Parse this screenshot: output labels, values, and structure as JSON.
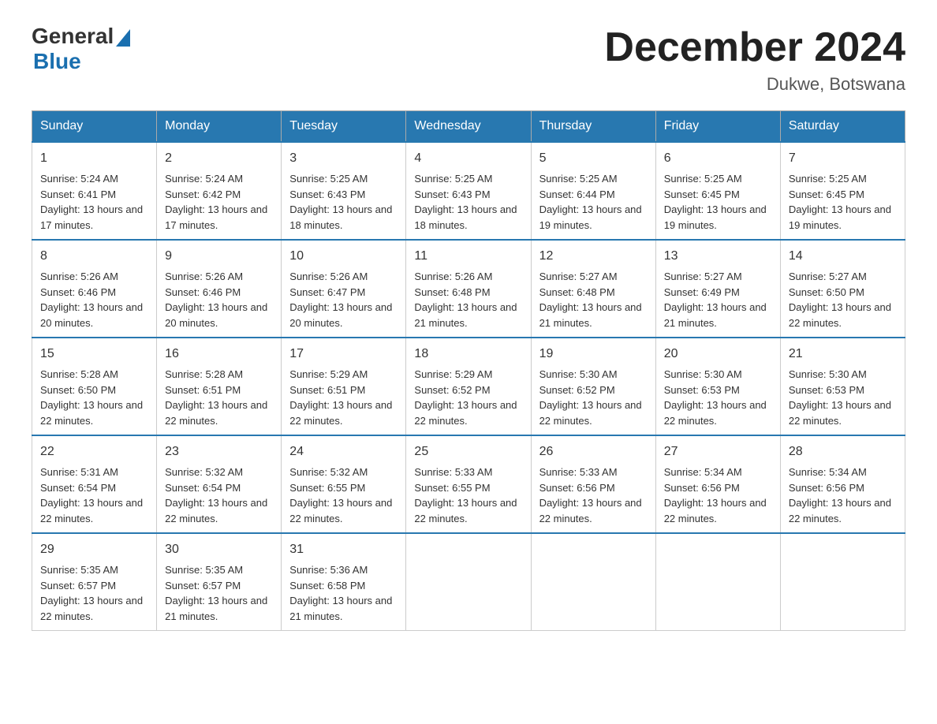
{
  "header": {
    "logo_general": "General",
    "logo_blue": "Blue",
    "main_title": "December 2024",
    "subtitle": "Dukwe, Botswana"
  },
  "calendar": {
    "days_of_week": [
      "Sunday",
      "Monday",
      "Tuesday",
      "Wednesday",
      "Thursday",
      "Friday",
      "Saturday"
    ],
    "weeks": [
      [
        {
          "day": "1",
          "sunrise": "5:24 AM",
          "sunset": "6:41 PM",
          "daylight": "13 hours and 17 minutes."
        },
        {
          "day": "2",
          "sunrise": "5:24 AM",
          "sunset": "6:42 PM",
          "daylight": "13 hours and 17 minutes."
        },
        {
          "day": "3",
          "sunrise": "5:25 AM",
          "sunset": "6:43 PM",
          "daylight": "13 hours and 18 minutes."
        },
        {
          "day": "4",
          "sunrise": "5:25 AM",
          "sunset": "6:43 PM",
          "daylight": "13 hours and 18 minutes."
        },
        {
          "day": "5",
          "sunrise": "5:25 AM",
          "sunset": "6:44 PM",
          "daylight": "13 hours and 19 minutes."
        },
        {
          "day": "6",
          "sunrise": "5:25 AM",
          "sunset": "6:45 PM",
          "daylight": "13 hours and 19 minutes."
        },
        {
          "day": "7",
          "sunrise": "5:25 AM",
          "sunset": "6:45 PM",
          "daylight": "13 hours and 19 minutes."
        }
      ],
      [
        {
          "day": "8",
          "sunrise": "5:26 AM",
          "sunset": "6:46 PM",
          "daylight": "13 hours and 20 minutes."
        },
        {
          "day": "9",
          "sunrise": "5:26 AM",
          "sunset": "6:46 PM",
          "daylight": "13 hours and 20 minutes."
        },
        {
          "day": "10",
          "sunrise": "5:26 AM",
          "sunset": "6:47 PM",
          "daylight": "13 hours and 20 minutes."
        },
        {
          "day": "11",
          "sunrise": "5:26 AM",
          "sunset": "6:48 PM",
          "daylight": "13 hours and 21 minutes."
        },
        {
          "day": "12",
          "sunrise": "5:27 AM",
          "sunset": "6:48 PM",
          "daylight": "13 hours and 21 minutes."
        },
        {
          "day": "13",
          "sunrise": "5:27 AM",
          "sunset": "6:49 PM",
          "daylight": "13 hours and 21 minutes."
        },
        {
          "day": "14",
          "sunrise": "5:27 AM",
          "sunset": "6:50 PM",
          "daylight": "13 hours and 22 minutes."
        }
      ],
      [
        {
          "day": "15",
          "sunrise": "5:28 AM",
          "sunset": "6:50 PM",
          "daylight": "13 hours and 22 minutes."
        },
        {
          "day": "16",
          "sunrise": "5:28 AM",
          "sunset": "6:51 PM",
          "daylight": "13 hours and 22 minutes."
        },
        {
          "day": "17",
          "sunrise": "5:29 AM",
          "sunset": "6:51 PM",
          "daylight": "13 hours and 22 minutes."
        },
        {
          "day": "18",
          "sunrise": "5:29 AM",
          "sunset": "6:52 PM",
          "daylight": "13 hours and 22 minutes."
        },
        {
          "day": "19",
          "sunrise": "5:30 AM",
          "sunset": "6:52 PM",
          "daylight": "13 hours and 22 minutes."
        },
        {
          "day": "20",
          "sunrise": "5:30 AM",
          "sunset": "6:53 PM",
          "daylight": "13 hours and 22 minutes."
        },
        {
          "day": "21",
          "sunrise": "5:30 AM",
          "sunset": "6:53 PM",
          "daylight": "13 hours and 22 minutes."
        }
      ],
      [
        {
          "day": "22",
          "sunrise": "5:31 AM",
          "sunset": "6:54 PM",
          "daylight": "13 hours and 22 minutes."
        },
        {
          "day": "23",
          "sunrise": "5:32 AM",
          "sunset": "6:54 PM",
          "daylight": "13 hours and 22 minutes."
        },
        {
          "day": "24",
          "sunrise": "5:32 AM",
          "sunset": "6:55 PM",
          "daylight": "13 hours and 22 minutes."
        },
        {
          "day": "25",
          "sunrise": "5:33 AM",
          "sunset": "6:55 PM",
          "daylight": "13 hours and 22 minutes."
        },
        {
          "day": "26",
          "sunrise": "5:33 AM",
          "sunset": "6:56 PM",
          "daylight": "13 hours and 22 minutes."
        },
        {
          "day": "27",
          "sunrise": "5:34 AM",
          "sunset": "6:56 PM",
          "daylight": "13 hours and 22 minutes."
        },
        {
          "day": "28",
          "sunrise": "5:34 AM",
          "sunset": "6:56 PM",
          "daylight": "13 hours and 22 minutes."
        }
      ],
      [
        {
          "day": "29",
          "sunrise": "5:35 AM",
          "sunset": "6:57 PM",
          "daylight": "13 hours and 22 minutes."
        },
        {
          "day": "30",
          "sunrise": "5:35 AM",
          "sunset": "6:57 PM",
          "daylight": "13 hours and 21 minutes."
        },
        {
          "day": "31",
          "sunrise": "5:36 AM",
          "sunset": "6:58 PM",
          "daylight": "13 hours and 21 minutes."
        },
        null,
        null,
        null,
        null
      ]
    ]
  }
}
